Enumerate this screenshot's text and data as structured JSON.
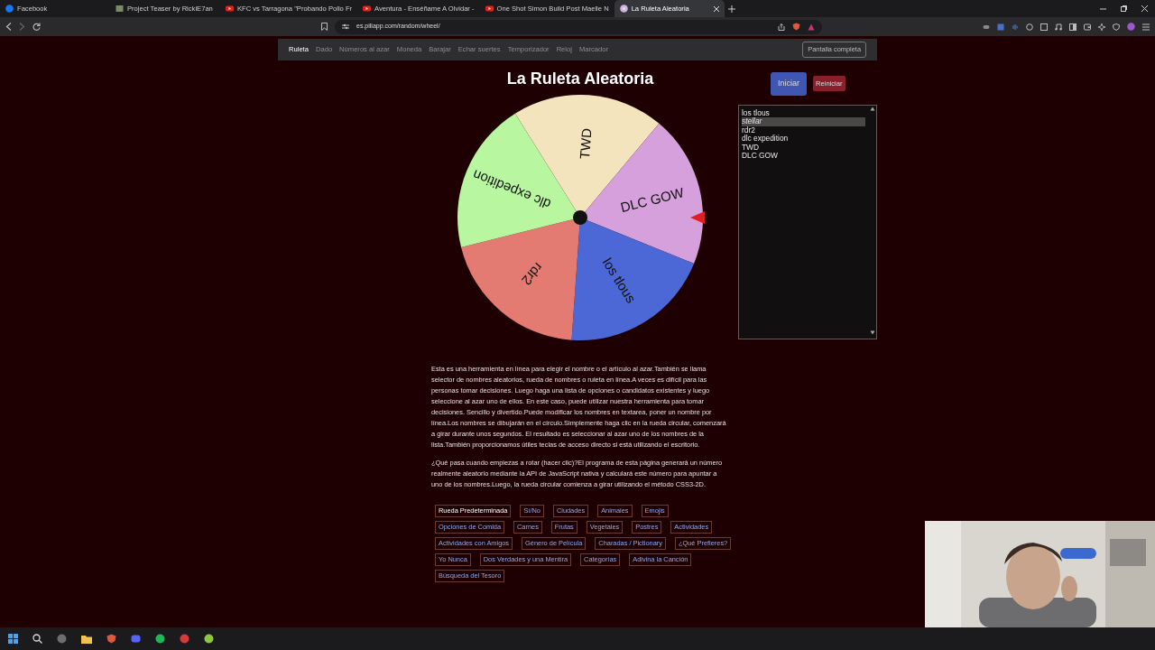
{
  "browser": {
    "tabs": [
      {
        "title": "Facebook",
        "kind": "social",
        "selected": false
      },
      {
        "title": "Project Teaser by RickiE7an",
        "kind": "page",
        "selected": false
      },
      {
        "title": "KFC vs Tarragona \"Probando Pollo Fr",
        "kind": "video",
        "selected": false
      },
      {
        "title": "Aventura - Enséñame A Olvidar -",
        "kind": "video",
        "selected": false
      },
      {
        "title": "One Shot Simon Build Post Maelle N",
        "kind": "video",
        "selected": false
      },
      {
        "title": "La Ruleta Aleatoria",
        "kind": "wheel",
        "selected": true
      }
    ],
    "address": "es.piliapp.com/random/wheel/"
  },
  "nav": {
    "items": [
      {
        "label": "Ruleta",
        "selected": true
      },
      {
        "label": "Dado",
        "selected": false
      },
      {
        "label": "Números al azar",
        "selected": false
      },
      {
        "label": "Moneda",
        "selected": false
      },
      {
        "label": "Barajar",
        "selected": false
      },
      {
        "label": "Echar suertes",
        "selected": false
      },
      {
        "label": "Temporizador",
        "selected": false
      },
      {
        "label": "Reloj",
        "selected": false
      },
      {
        "label": "Marcador",
        "selected": false
      }
    ],
    "fullscreen_button": "Pantalla completa"
  },
  "title": "La Ruleta Aleatoria",
  "buttons": {
    "start": "Iniciar",
    "reset": "Reiniciar"
  },
  "wheel": {
    "slices": [
      {
        "label": "TWD",
        "color": "#f3e4bd"
      },
      {
        "label": "DLC GOW",
        "color": "#d6a0dc"
      },
      {
        "label": "los tlous",
        "color": "#4c68d6"
      },
      {
        "label": "rdr2",
        "color": "#e47b72"
      },
      {
        "label": "dlc expedition",
        "color": "#b8f6a0"
      }
    ]
  },
  "name_list": [
    {
      "text": "los tlous",
      "selected": false
    },
    {
      "text": "stellar",
      "selected": true
    },
    {
      "text": "rdr2",
      "selected": false
    },
    {
      "text": "dlc expedition",
      "selected": false
    },
    {
      "text": "TWD",
      "selected": false
    },
    {
      "text": "DLC GOW",
      "selected": false
    }
  ],
  "description": [
    "Esta es una herramienta en línea para elegir el nombre o el artículo al azar.También se llama selector de nombres aleatorios, rueda de nombres o ruleta en línea.A veces es difícil para las personas tomar decisiones. Luego haga una lista de opciones o candidatos existentes y luego seleccione al azar uno de ellos. En este caso, puede utilizar nuestra herramienta para tomar decisiones. Sencillo y divertido.Puede modificar los nombres en textarea, poner un nombre por línea.Los nombres se dibujarán en el círculo.Simplemente haga clic en la rueda circular, comenzará a girar durante unos segundos. El resultado es seleccionar al azar uno de los nombres de la lista.También proporcionamos útiles teclas de acceso directo si está utilizando el escritorio.",
    "¿Qué pasa cuando empiezas a rotar (hacer clic)?El programa de esta página generará un número realmente aleatorio mediante la API de JavaScript nativa y calculará este número para apuntar a uno de los nombres.Luego, la rueda circular comienza a girar utilizando el método CSS3-2D."
  ],
  "presets": [
    {
      "label": "Rueda Predeterminada",
      "selected": true
    },
    {
      "label": "Sí/No",
      "selected": false
    },
    {
      "label": "Ciudades",
      "selected": false
    },
    {
      "label": "Animales",
      "selected": false
    },
    {
      "label": "Emojis",
      "selected": false
    },
    {
      "label": "Opciones de Comida",
      "selected": false
    },
    {
      "label": "Carnes",
      "selected": false
    },
    {
      "label": "Frutas",
      "selected": false
    },
    {
      "label": "Vegetales",
      "selected": false
    },
    {
      "label": "Postres",
      "selected": false
    },
    {
      "label": "Actividades",
      "selected": false
    },
    {
      "label": "Actividades con Amigos",
      "selected": false
    },
    {
      "label": "Género de Película",
      "selected": false
    },
    {
      "label": "Charadas / Pictionary",
      "selected": false
    },
    {
      "label": "¿Qué Prefieres?",
      "selected": false
    },
    {
      "label": "Yo Nunca",
      "selected": false
    },
    {
      "label": "Dos Verdades y una Mentira",
      "selected": false
    },
    {
      "label": "Categorías",
      "selected": false
    },
    {
      "label": "Adivina la Canción",
      "selected": false
    },
    {
      "label": "Búsqueda del Tesoro",
      "selected": false
    }
  ]
}
